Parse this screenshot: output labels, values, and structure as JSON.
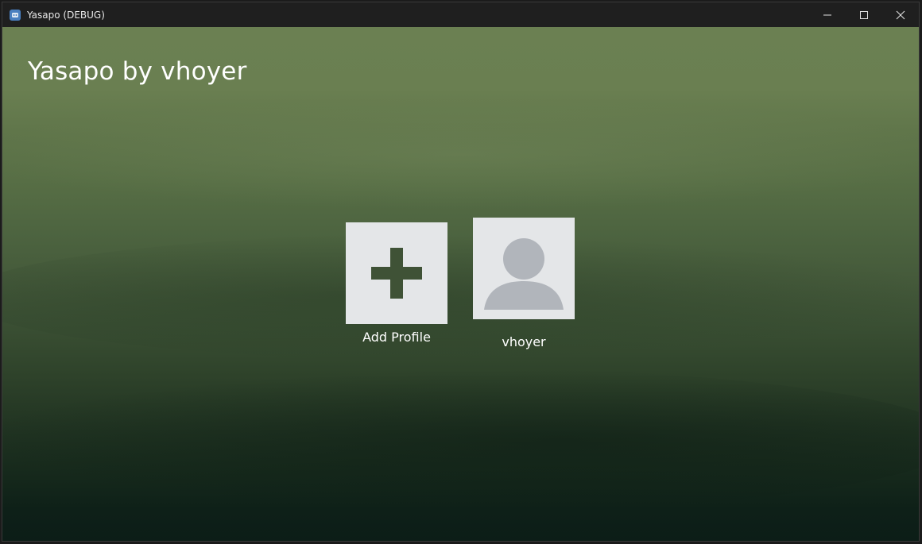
{
  "window": {
    "title": "Yasapo (DEBUG)"
  },
  "app": {
    "heading": "Yasapo by vhoyer"
  },
  "profiles": {
    "add_label": "Add Profile",
    "items": [
      {
        "name": "vhoyer"
      }
    ]
  },
  "colors": {
    "tile_bg": "#e4e6e8",
    "plus_icon": "#3f5236",
    "avatar_icon": "#b1b5bb"
  },
  "icons": {
    "add": "plus-icon",
    "avatar": "user-avatar-icon",
    "minimize": "minimize-icon",
    "maximize": "maximize-icon",
    "close": "close-icon"
  }
}
